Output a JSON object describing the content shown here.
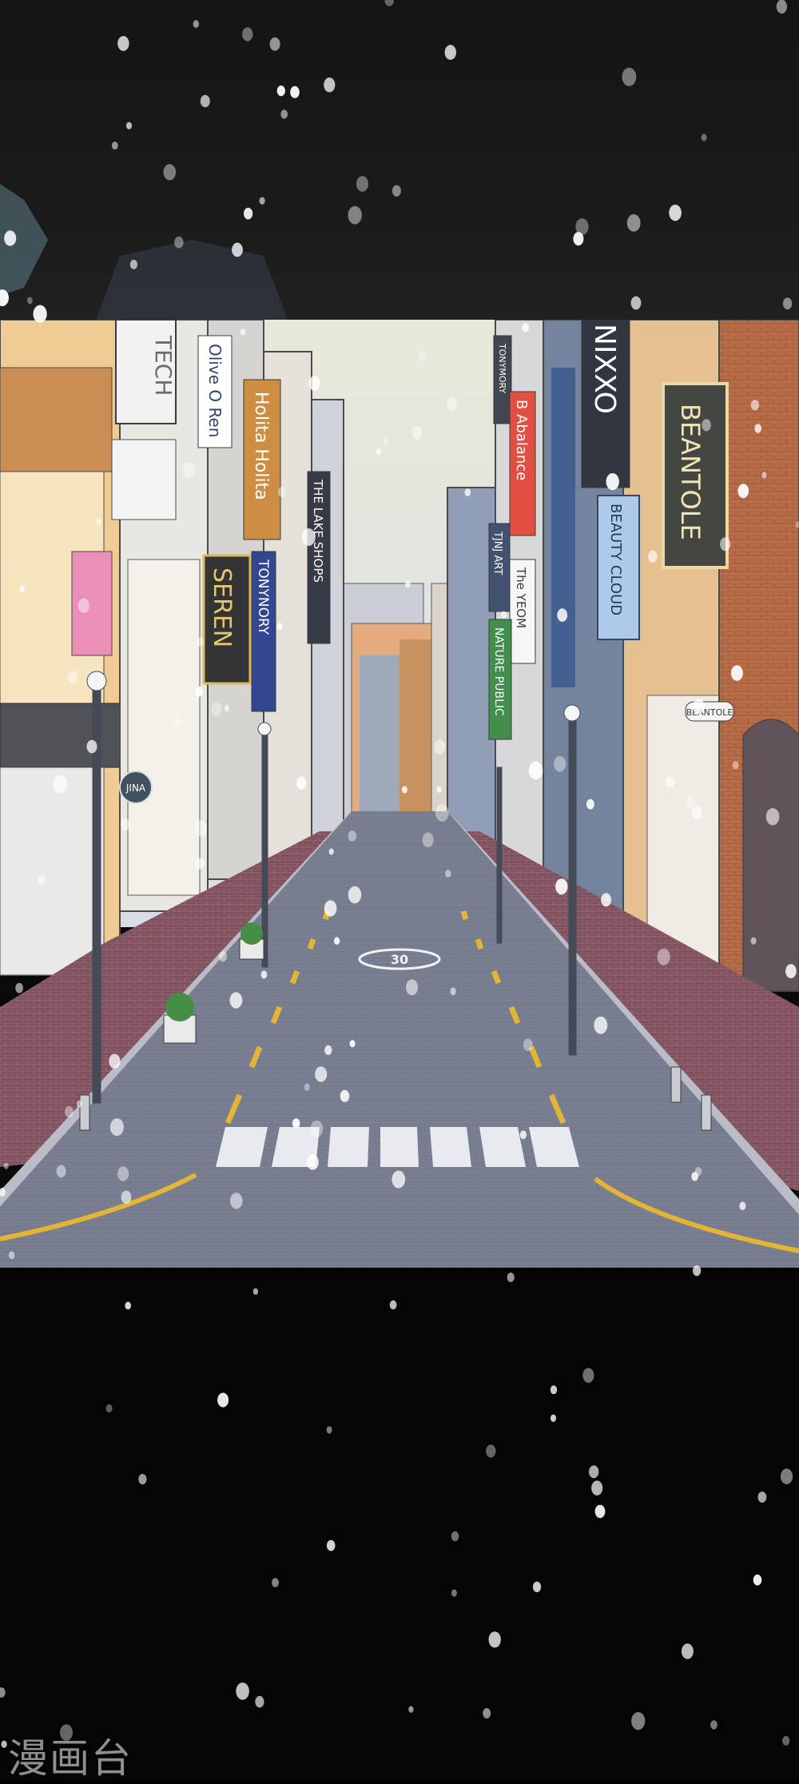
{
  "watermark": "漫画台",
  "signs": {
    "tech": "TECH",
    "olive_ren": "Olive O Ren",
    "holita": "Holita Holita",
    "seren": "SEREN",
    "tonynory": "TONYNORY",
    "lake_shops": "THE LAKE SHOPS",
    "tonymory_small": "TONYMORY",
    "abalance": "B Abalance",
    "nixxo": "NIXXO",
    "beantole": "BEANTOLE",
    "beauty_cloud": "BEAUTY CLOUD",
    "tjnj_art": "TJNJ ART",
    "the_yeom": "The YEOM",
    "nature_public": "NATURE PUBLIC",
    "beantole_small": "BEANTOLE",
    "jina": "JINA",
    "speed_marking": "30"
  }
}
